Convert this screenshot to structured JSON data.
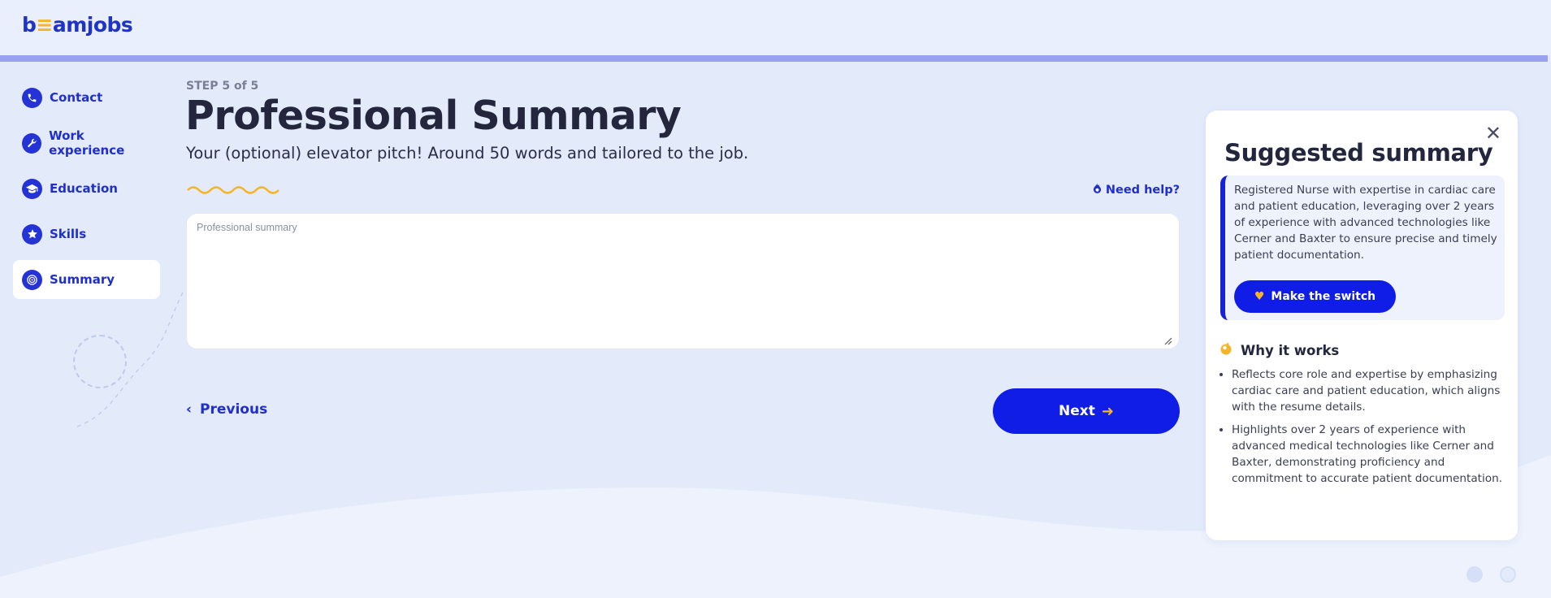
{
  "brand": {
    "logo_pre": "b",
    "logo_e": "≡",
    "logo_post": "amjobs"
  },
  "progress": {
    "fraction": 1.0
  },
  "sidebar": {
    "items": [
      {
        "label": "Contact",
        "icon": "phone-icon",
        "active": false
      },
      {
        "label": "Work experience",
        "icon": "wrench-icon",
        "active": false
      },
      {
        "label": "Education",
        "icon": "graduation-cap-icon",
        "active": false
      },
      {
        "label": "Skills",
        "icon": "star-icon",
        "active": false
      },
      {
        "label": "Summary",
        "icon": "target-icon",
        "active": true
      }
    ]
  },
  "main": {
    "step": "STEP 5 of 5",
    "title": "Professional Summary",
    "subtitle": "Your (optional) elevator pitch! Around 50 words and tailored to the job.",
    "need_help": "Need help?",
    "summary_placeholder": "Professional summary",
    "summary_value": "",
    "previous_label": "Previous",
    "next_label": "Next"
  },
  "panel": {
    "title": "Suggested summary",
    "close_label": "✕",
    "suggestion": "Registered Nurse with expertise in cardiac care and patient education, leveraging over 2 years of experience with advanced technologies like Cerner and Baxter to ensure precise and timely patient documentation.",
    "switch_label": "Make the switch",
    "why_title": "Why it works",
    "why_items": [
      "Reflects core role and expertise by emphasizing cardiac care and patient education, which aligns with the resume details.",
      "Highlights over 2 years of experience with advanced medical technologies like Cerner and Baxter, demonstrating proficiency and commitment to accurate patient documentation."
    ]
  },
  "colors": {
    "primary": "#0f1de6",
    "accent": "#f4b526",
    "background": "#e3ebfb",
    "text_dark": "#23263d"
  }
}
